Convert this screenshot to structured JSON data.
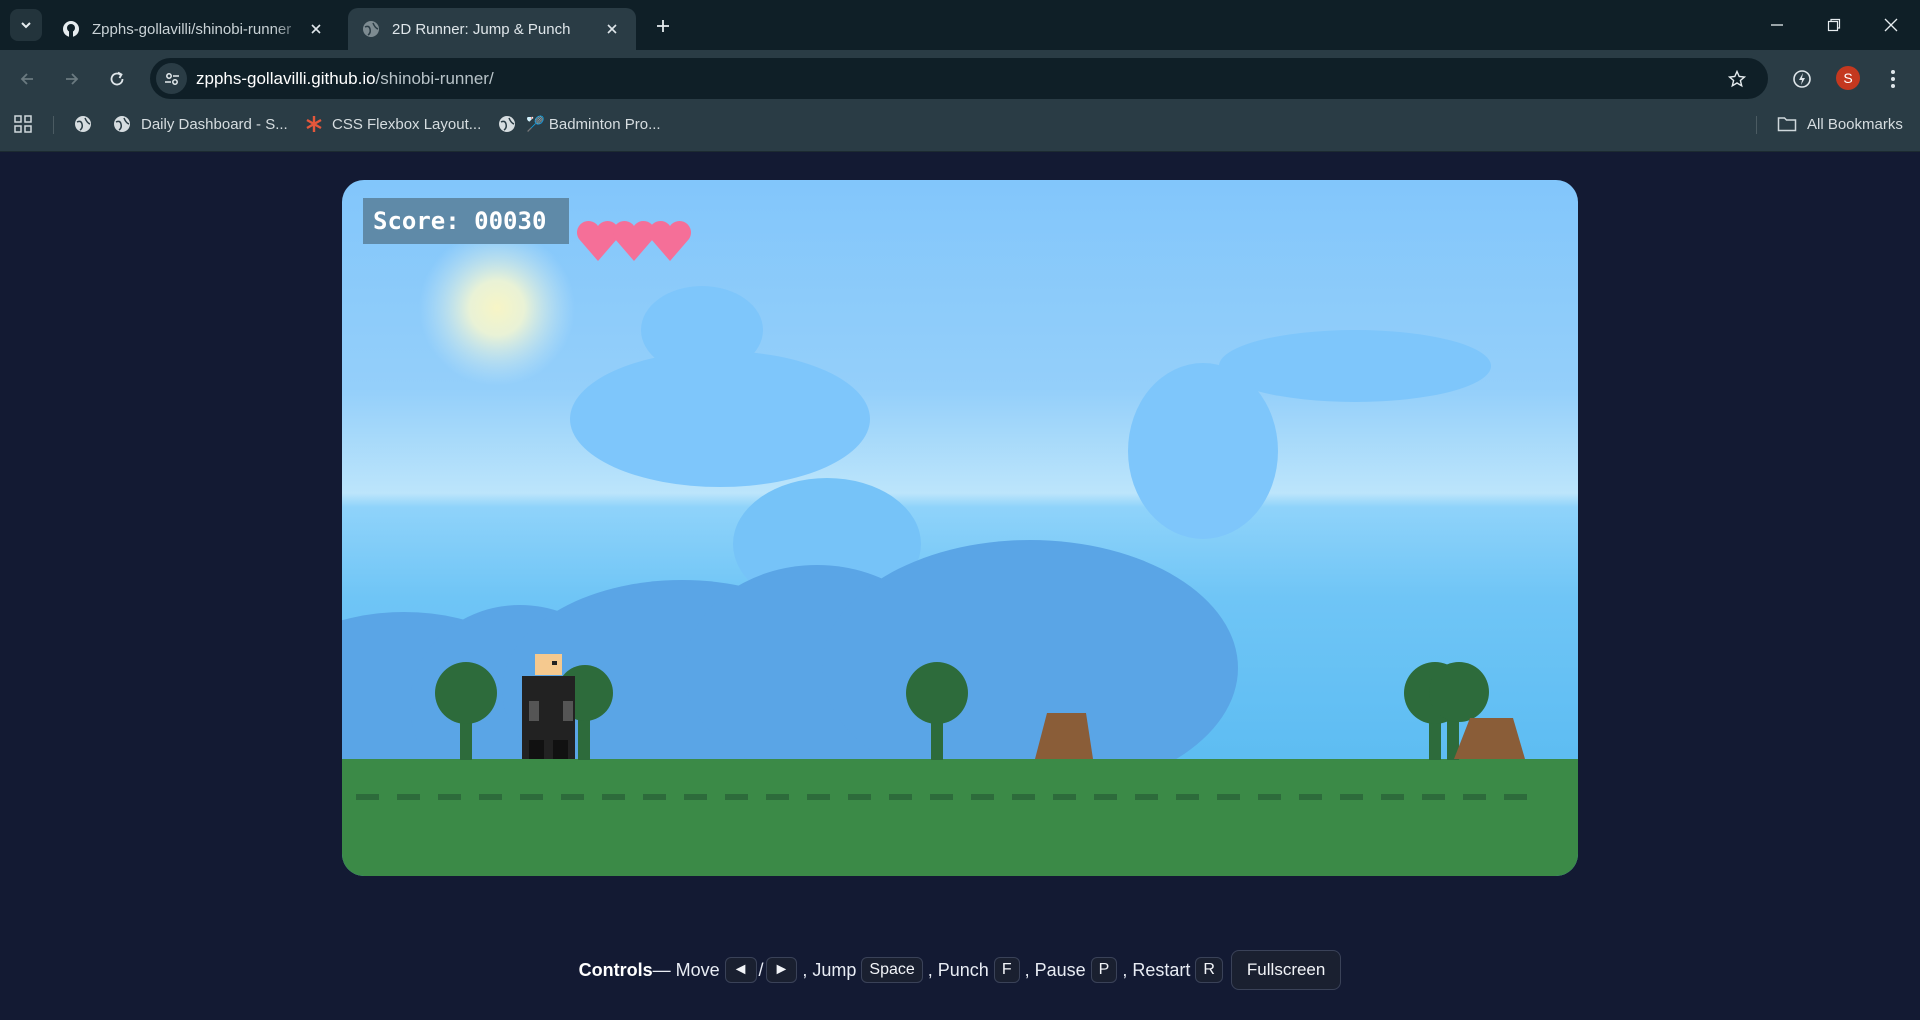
{
  "browser": {
    "tabs": [
      {
        "title": "Zpphs-gollavilli/shinobi-runner",
        "icon": "github-icon",
        "active": false
      },
      {
        "title": "2D Runner: Jump & Punch",
        "icon": "globe-icon",
        "active": true
      }
    ],
    "url_host": "zpphs-gollavilli.github.io",
    "url_path": "/shinobi-runner/",
    "avatar_letter": "S",
    "bookmarks": [
      {
        "label": "",
        "icon": "globe-icon"
      },
      {
        "label": "Daily Dashboard - S...",
        "icon": "globe-icon"
      },
      {
        "label": "CSS Flexbox Layout...",
        "icon": "asterisk-icon"
      },
      {
        "label": "🏸 Badminton Pro...",
        "icon": "globe-icon"
      }
    ],
    "all_bookmarks": "All Bookmarks"
  },
  "game": {
    "score_label": "Score: 00030",
    "lives": 3,
    "colors": {
      "sky": "#82c6fb",
      "cloud": "#7ec6fb",
      "hills": "#5aa5e6",
      "grass": "#3b8a47",
      "tree": "#2d6b3b",
      "obstacle": "#8a5d38",
      "heart": "#f56f98",
      "player_body": "#222222",
      "player_head": "#f5c98f"
    }
  },
  "controls": {
    "heading": "Controls",
    "dash": " — Move",
    "left_key": "◄",
    "slash": "/",
    "right_key": "►",
    "jump_label": ", Jump",
    "jump_key": "Space",
    "punch_label": ", Punch",
    "punch_key": "F",
    "pause_label": ", Pause",
    "pause_key": "P",
    "restart_label": ", Restart",
    "restart_key": "R",
    "fullscreen_label": "Fullscreen"
  }
}
